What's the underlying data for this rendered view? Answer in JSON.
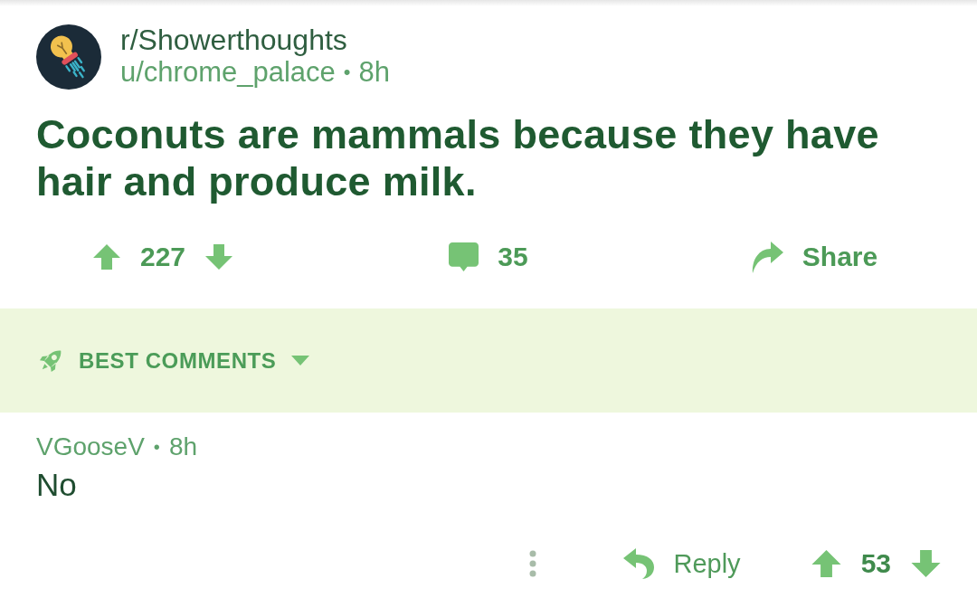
{
  "post": {
    "subreddit": "r/Showerthoughts",
    "author": "u/chrome_palace",
    "separator": "•",
    "age": "8h",
    "title": "Coconuts are mammals because they have hair and produce milk.",
    "score": "227",
    "comment_count": "35",
    "share_label": "Share"
  },
  "sort": {
    "label": "BEST COMMENTS"
  },
  "comments": [
    {
      "author": "VGooseV",
      "separator": "•",
      "age": "8h",
      "body": "No",
      "reply_label": "Reply",
      "score": "53"
    }
  ]
}
